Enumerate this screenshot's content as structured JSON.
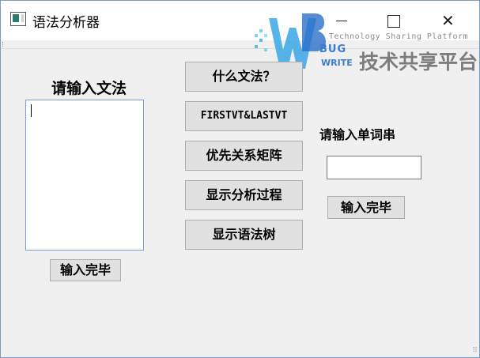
{
  "window": {
    "title": "语法分析器"
  },
  "watermark": {
    "tagline": "Technology Sharing Platform",
    "bug": "BUG",
    "write": "WRITE",
    "chinese": "技术共享平台"
  },
  "left": {
    "grammar_label": "请输入文法",
    "grammar_value": "",
    "grammar_done_label": "输入完毕"
  },
  "middle": {
    "buttons": [
      {
        "label": "什么文法？"
      },
      {
        "label": "FIRSTVT&LASTVT"
      },
      {
        "label": "优先关系矩阵"
      },
      {
        "label": "显示分析过程"
      },
      {
        "label": "显示语法树"
      }
    ]
  },
  "right": {
    "word_label": "请输入单词串",
    "word_value": "",
    "word_done_label": "输入完毕"
  },
  "colors": {
    "button_bg": "#e1e1e1",
    "button_border": "#adadad",
    "window_bg": "#f0f0f0",
    "input_border": "#7a9cd3",
    "watermark_blue": "#3a7bd5"
  },
  "icons": {
    "app": "app-window-icon",
    "minimize": "minimize-icon",
    "maximize": "maximize-icon",
    "close": "close-icon",
    "resize": "resize-grip-icon"
  }
}
